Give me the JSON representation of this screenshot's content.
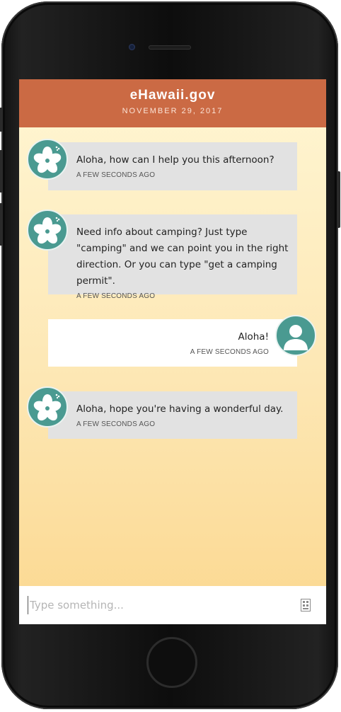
{
  "app": {
    "title": "eHawaii.gov",
    "date": "NOVEMBER 29, 2017"
  },
  "messages": [
    {
      "sender": "bot",
      "text": "Aloha, how can I help you this afternoon?",
      "time": "A FEW SECONDS AGO",
      "avatar_icon": "hibiscus-icon"
    },
    {
      "sender": "bot",
      "text": "Need info about camping? Just type \"camping\" and we can point you in the right direction. Or you can type \"get a camping permit\".",
      "time": "A FEW SECONDS AGO",
      "avatar_icon": "hibiscus-icon"
    },
    {
      "sender": "user",
      "text": "Aloha!",
      "time": "A FEW SECONDS AGO",
      "avatar_icon": "user-silhouette-icon"
    },
    {
      "sender": "bot",
      "text": "Aloha, hope you're having a wonderful day.",
      "time": "A FEW SECONDS AGO",
      "avatar_icon": "hibiscus-icon"
    }
  ],
  "input": {
    "placeholder": "Type something...",
    "value": "",
    "action_icon": "keyboard-icon"
  },
  "colors": {
    "header": "#cb6a44",
    "avatar": "#4a9a91",
    "bot_bubble": "#e2e2e2",
    "user_bubble": "#ffffff",
    "background_top": "#fff6d3",
    "background_bottom": "#fbd890"
  }
}
